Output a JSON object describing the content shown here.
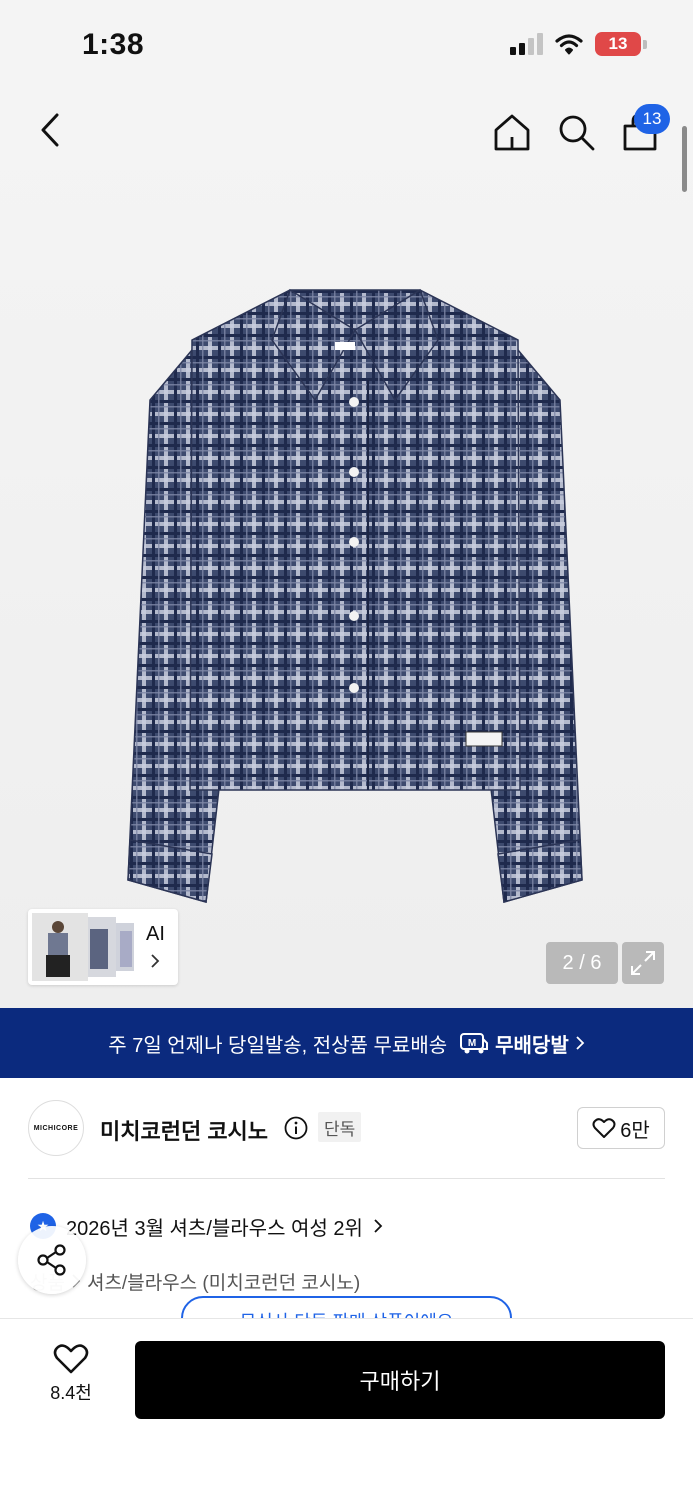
{
  "status_bar": {
    "time": "1:38",
    "battery": "13"
  },
  "nav": {
    "cart_count": "13"
  },
  "gallery": {
    "counter": "2 / 6",
    "ai_label": "AI"
  },
  "banner": {
    "text": "주 7일 언제나 당일발송, 전상품 무료배송",
    "brand": "무배당발",
    "brand_icon": "M"
  },
  "shop": {
    "logo_text": "MICHICORE",
    "name": "미치코런던 코시노",
    "exclusive_tag": "단독",
    "like_count": "6만"
  },
  "ranking": {
    "text": "2026년 3월 셔츠/블라우스 여성 2위"
  },
  "category": {
    "prefix": "상품",
    "path": "셔츠/블라우스 (미치코런던 코시노)"
  },
  "promo_chip": {
    "text": "무신사 단독 판매 상품이에요"
  },
  "bottom_bar": {
    "wish_count": "8.4천",
    "buy_label": "구매하기"
  },
  "colors": {
    "accent_blue": "#1f63e6",
    "banner_navy": "#0b2a7e",
    "buy_black": "#000000"
  }
}
